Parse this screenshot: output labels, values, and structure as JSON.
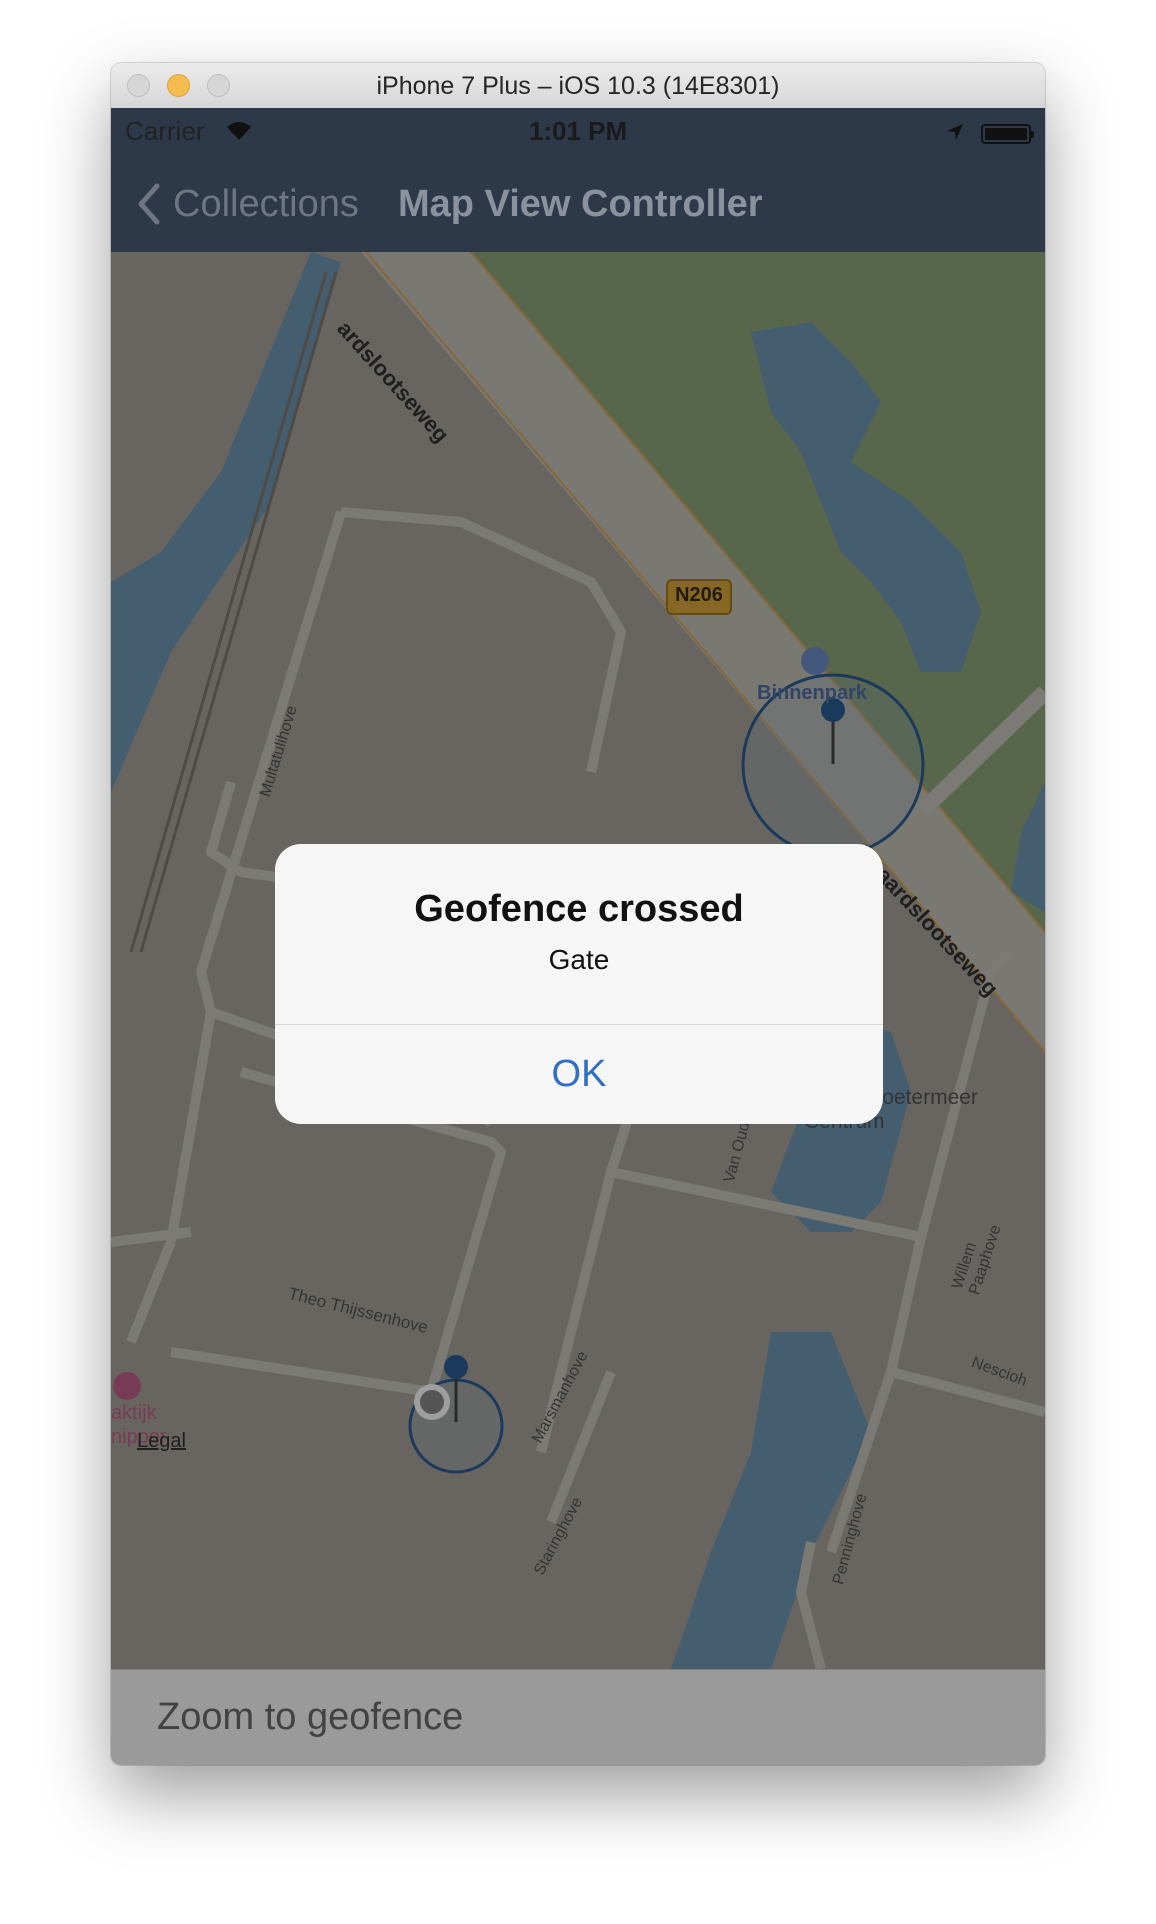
{
  "window": {
    "title": "iPhone 7 Plus – iOS 10.3 (14E8301)"
  },
  "status_bar": {
    "carrier": "Carrier",
    "time": "1:01 PM"
  },
  "nav": {
    "back_label": "Collections",
    "title": "Map View Controller"
  },
  "map": {
    "labels": {
      "road_top": "ardslootseweg",
      "road_badge": "N206",
      "poi_binnenpark": "Binnenpark",
      "road_right": "Zwaardslootseweg",
      "street_multatuli": "Multatulihove",
      "poi_kubus_line1": "Kubus Zoetermeer",
      "poi_kubus_line2": "Centrum",
      "street_vanoudsho": "Van Oudsho",
      "street_theo": "Theo Thijssenhove",
      "street_willem": "Willem Paaphove",
      "street_nescio": "Nescioh",
      "street_marsman": "Marsmanhove",
      "street_staring": "Staringhove",
      "street_penning": "Penninghove",
      "poi_praktijk_line1": "aktijk",
      "poi_praktijk_line2": "nipper",
      "legal": "Legal"
    },
    "colors": {
      "land": "#a8a49b",
      "park": "#8ea67a",
      "water": "#6f96b3",
      "road": "#c9c5bc",
      "pin": "#2d5e93"
    }
  },
  "alert": {
    "title": "Geofence crossed",
    "message": "Gate",
    "ok_label": "OK"
  },
  "bottom_bar": {
    "label": "Zoom to geofence"
  }
}
